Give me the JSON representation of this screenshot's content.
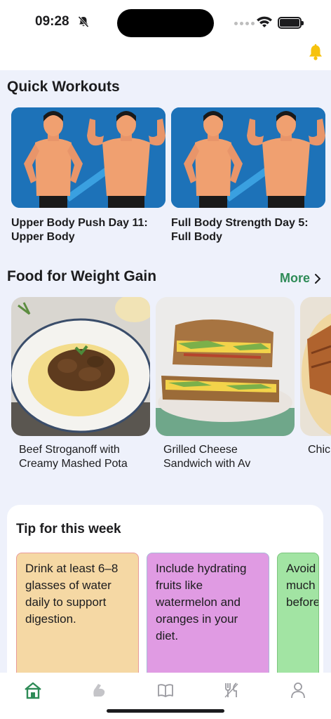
{
  "status_bar": {
    "time": "09:28"
  },
  "quick_workouts": {
    "title": "Quick Workouts",
    "cards": [
      {
        "title_line1": "Upper Body Push Day 11:",
        "title_line2": "Upper Body"
      },
      {
        "title_line1": "Full Body Strength Day 5:",
        "title_line2": "Full Body"
      }
    ]
  },
  "food": {
    "title": "Food for Weight Gain",
    "more_label": "More",
    "cards": [
      {
        "title_line1": "Beef Stroganoff with",
        "title_line2": "Creamy Mashed Pota"
      },
      {
        "title_line1": "Grilled Cheese",
        "title_line2": "Sandwich with Av"
      },
      {
        "title_line1": "Chic",
        "title_line2": ""
      }
    ]
  },
  "tips": {
    "title": "Tip for this week",
    "cards": [
      {
        "text": "Drink at least 6–8 glasses of water daily to support digestion.",
        "bg": "#f5d8a4",
        "border": "#e89a9a"
      },
      {
        "text": "Include hydrating fruits like watermelon and oranges in your diet.",
        "bg": "#e09be3",
        "border": "#a9b8d6"
      },
      {
        "text": "Avoid much before",
        "bg": "#a2e4a3",
        "border": "#7cc47e"
      }
    ]
  },
  "colors": {
    "accent": "#2e8b57",
    "background": "#eef1fb",
    "bell": "#f6c20d"
  },
  "tab_bar": {
    "active": "home",
    "icons": [
      "home-icon",
      "dumbbell-icon",
      "book-icon",
      "utensils-icon",
      "profile-icon"
    ]
  }
}
